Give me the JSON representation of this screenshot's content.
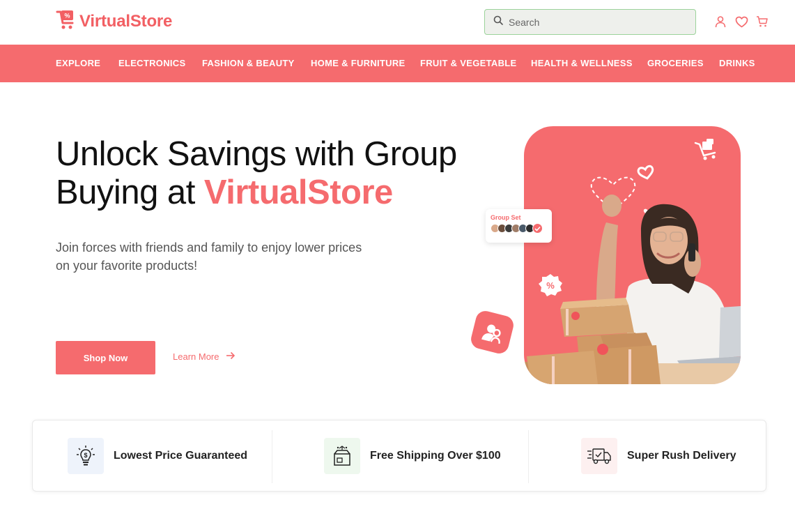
{
  "brand": {
    "name": "VirtualStore",
    "accent": "#f56b6e"
  },
  "search": {
    "placeholder": "Search"
  },
  "header_icons": [
    "user-icon",
    "heart-icon",
    "cart-icon"
  ],
  "nav": {
    "items": [
      {
        "label": "EXPLORE"
      },
      {
        "label": "ELECTRONICS"
      },
      {
        "label": "FASHION & BEAUTY"
      },
      {
        "label": "HOME & FURNITURE"
      },
      {
        "label": "FRUIT & VEGETABLE"
      },
      {
        "label": "HEALTH & WELLNESS"
      },
      {
        "label": "GROCERIES"
      },
      {
        "label": "DRINKS"
      }
    ]
  },
  "hero": {
    "title_line1": "Unlock Savings with Group",
    "title_line2_prefix": "Buying at ",
    "title_line2_accent": "VirtualStore",
    "subtitle": "Join forces with friends and family to enjoy lower prices on your favorite products!",
    "shop_now": "Shop Now",
    "learn_more": "Learn More",
    "group_set_label": "Group Set"
  },
  "features": [
    {
      "label": "Lowest Price Guaranteed",
      "icon": "lightbulb-dollar-icon",
      "bg": "#eef3fb"
    },
    {
      "label": "Free Shipping Over $100",
      "icon": "package-icon",
      "bg": "#eef8ee"
    },
    {
      "label": "Super Rush Delivery",
      "icon": "delivery-truck-icon",
      "bg": "#fdf0f0"
    }
  ]
}
